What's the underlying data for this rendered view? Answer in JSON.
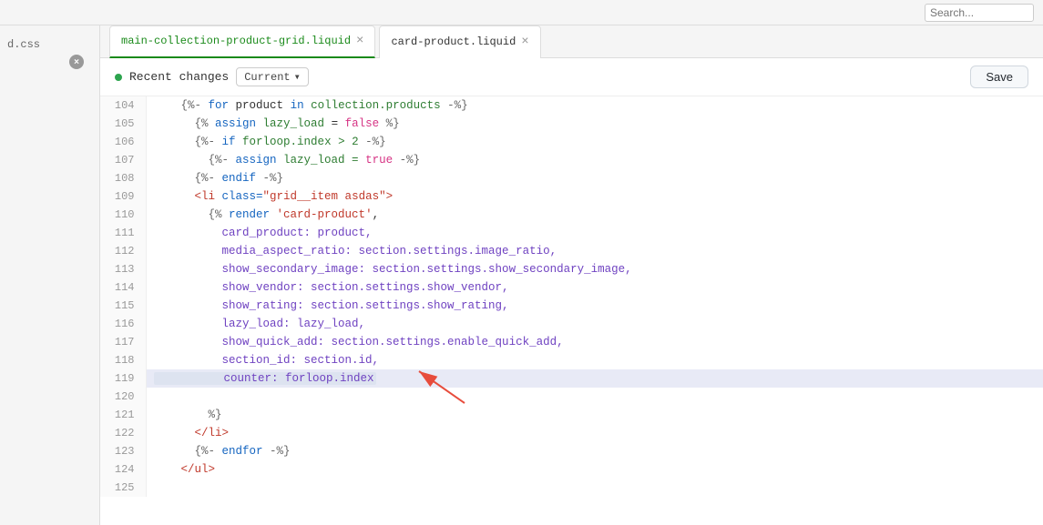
{
  "topbar": {
    "search_placeholder": "Search..."
  },
  "sidebar": {
    "close_icon": "×",
    "label": "d.css"
  },
  "tabs": [
    {
      "id": "tab1",
      "label": "main-collection-product-grid.liquid",
      "active": true,
      "closable": true
    },
    {
      "id": "tab2",
      "label": "card-product.liquid",
      "active": false,
      "closable": true
    }
  ],
  "editor_header": {
    "recent_changes_label": "Recent changes",
    "current_label": "Current",
    "save_label": "Save"
  },
  "lines": [
    {
      "num": 104,
      "tokens": [
        {
          "t": "    ",
          "c": ""
        },
        {
          "t": "{%- ",
          "c": "liquid-bracket"
        },
        {
          "t": "for",
          "c": "tag-keyword"
        },
        {
          "t": " product ",
          "c": ""
        },
        {
          "t": "in",
          "c": "tag-keyword"
        },
        {
          "t": " collection.products ",
          "c": "variable"
        },
        {
          "t": "-%}",
          "c": "liquid-bracket"
        }
      ]
    },
    {
      "num": 105,
      "tokens": [
        {
          "t": "      ",
          "c": ""
        },
        {
          "t": "{%",
          "c": "liquid-bracket"
        },
        {
          "t": " assign ",
          "c": "tag-keyword"
        },
        {
          "t": "lazy_load",
          "c": "variable"
        },
        {
          "t": " = ",
          "c": ""
        },
        {
          "t": "false",
          "c": "keyword"
        },
        {
          "t": " %}",
          "c": "liquid-bracket"
        }
      ]
    },
    {
      "num": 106,
      "tokens": [
        {
          "t": "      ",
          "c": ""
        },
        {
          "t": "{%- ",
          "c": "liquid-bracket"
        },
        {
          "t": "if",
          "c": "tag-keyword"
        },
        {
          "t": " forloop.index > 2 ",
          "c": "variable"
        },
        {
          "t": "-%}",
          "c": "liquid-bracket"
        }
      ]
    },
    {
      "num": 107,
      "tokens": [
        {
          "t": "        ",
          "c": ""
        },
        {
          "t": "{%- ",
          "c": "liquid-bracket"
        },
        {
          "t": "assign",
          "c": "tag-keyword"
        },
        {
          "t": " lazy_load = ",
          "c": "variable"
        },
        {
          "t": "true",
          "c": "keyword"
        },
        {
          "t": " -%}",
          "c": "liquid-bracket"
        }
      ]
    },
    {
      "num": 108,
      "tokens": [
        {
          "t": "      ",
          "c": ""
        },
        {
          "t": "{%- ",
          "c": "liquid-bracket"
        },
        {
          "t": "endif",
          "c": "tag-keyword"
        },
        {
          "t": " -%}",
          "c": "liquid-bracket"
        }
      ]
    },
    {
      "num": 109,
      "tokens": [
        {
          "t": "      ",
          "c": ""
        },
        {
          "t": "<li",
          "c": "html-tag"
        },
        {
          "t": " class=",
          "c": "attr"
        },
        {
          "t": "\"grid__item asdas\"",
          "c": "string"
        },
        {
          "t": ">",
          "c": "html-tag"
        }
      ]
    },
    {
      "num": 110,
      "tokens": [
        {
          "t": "        ",
          "c": ""
        },
        {
          "t": "{%",
          "c": "liquid-bracket"
        },
        {
          "t": " render ",
          "c": "tag-keyword"
        },
        {
          "t": "'card-product'",
          "c": "string"
        },
        {
          "t": ",",
          "c": ""
        }
      ]
    },
    {
      "num": 111,
      "tokens": [
        {
          "t": "          card_product: product,",
          "c": "property"
        }
      ]
    },
    {
      "num": 112,
      "tokens": [
        {
          "t": "          media_aspect_ratio: section.settings.image_ratio,",
          "c": "property"
        }
      ]
    },
    {
      "num": 113,
      "tokens": [
        {
          "t": "          show_secondary_image: section.settings.show_secondary_image,",
          "c": "property"
        }
      ]
    },
    {
      "num": 114,
      "tokens": [
        {
          "t": "          show_vendor: section.settings.show_vendor,",
          "c": "property"
        }
      ]
    },
    {
      "num": 115,
      "tokens": [
        {
          "t": "          show_rating: section.settings.show_rating,",
          "c": "property"
        }
      ]
    },
    {
      "num": 116,
      "tokens": [
        {
          "t": "          lazy_load: lazy_load,",
          "c": "property"
        }
      ]
    },
    {
      "num": 117,
      "tokens": [
        {
          "t": "          show_quick_add: section.settings.enable_quick_add,",
          "c": "property"
        }
      ]
    },
    {
      "num": 118,
      "tokens": [
        {
          "t": "          section_id: section.id,",
          "c": "property"
        }
      ]
    },
    {
      "num": 119,
      "tokens": [
        {
          "t": "          counter: forloop.index",
          "c": "property",
          "highlight": true
        }
      ]
    },
    {
      "num": 120,
      "tokens": [
        {
          "t": "",
          "c": ""
        }
      ]
    },
    {
      "num": 121,
      "tokens": [
        {
          "t": "        ",
          "c": ""
        },
        {
          "t": "%}",
          "c": "liquid-bracket"
        }
      ]
    },
    {
      "num": 122,
      "tokens": [
        {
          "t": "      ",
          "c": ""
        },
        {
          "t": "</li>",
          "c": "html-tag"
        }
      ]
    },
    {
      "num": 123,
      "tokens": [
        {
          "t": "      ",
          "c": ""
        },
        {
          "t": "{%- ",
          "c": "liquid-bracket"
        },
        {
          "t": "endfor",
          "c": "tag-keyword"
        },
        {
          "t": " -%}",
          "c": "liquid-bracket"
        }
      ]
    },
    {
      "num": 124,
      "tokens": [
        {
          "t": "    ",
          "c": ""
        },
        {
          "t": "</ul>",
          "c": "html-tag"
        }
      ]
    },
    {
      "num": 125,
      "tokens": [
        {
          "t": "",
          "c": ""
        }
      ]
    }
  ],
  "arrow": {
    "visible": true,
    "color": "#e74c3c"
  }
}
